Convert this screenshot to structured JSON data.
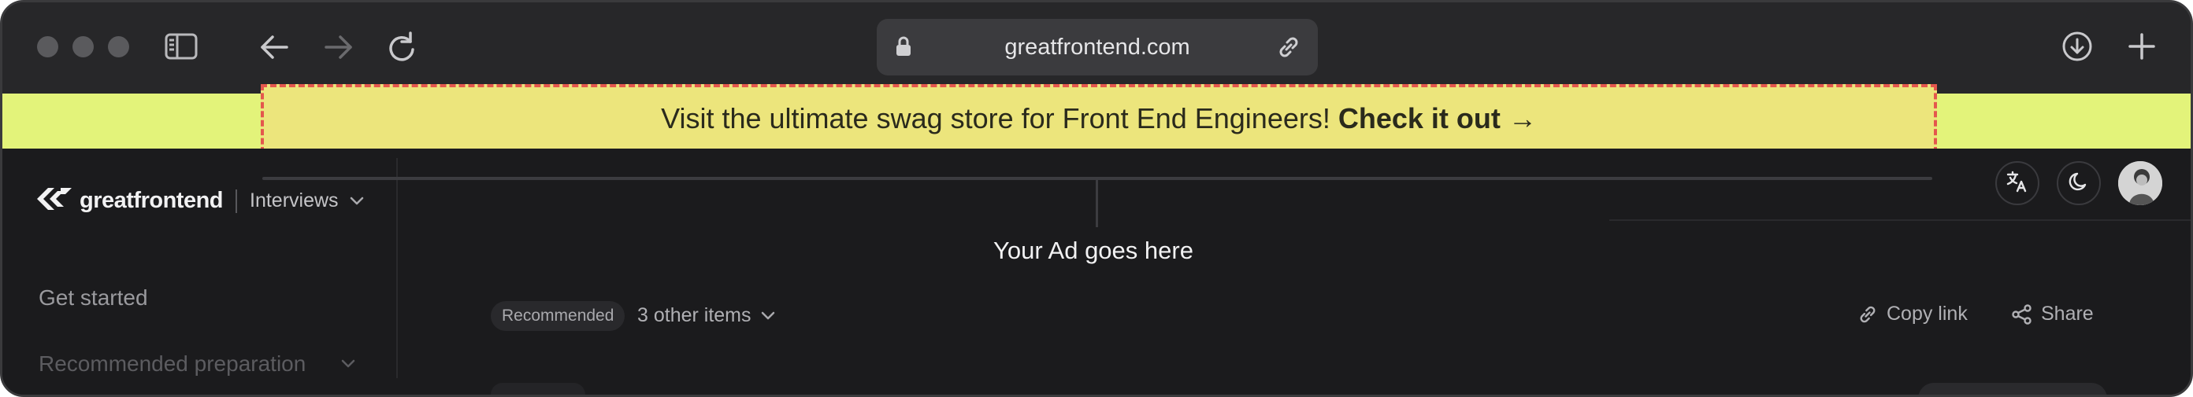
{
  "browser": {
    "url": "greatfrontend.com",
    "icons": [
      "sidebar-toggle-icon",
      "back-arrow-icon",
      "forward-arrow-icon",
      "reload-icon",
      "lock-icon",
      "link-icon",
      "download-icon",
      "plus-icon"
    ]
  },
  "banner": {
    "text": "Visit the ultimate swag store for Front End Engineers!",
    "cta": "Check it out →",
    "background": "#e3f37a"
  },
  "site": {
    "logo_text": "greatfrontend",
    "product_menu": "Interviews"
  },
  "sidebar": {
    "items": [
      {
        "label": "Get started"
      },
      {
        "label": "Recommended preparation"
      }
    ]
  },
  "ad": {
    "text": "Your Ad goes here"
  },
  "header_actions": {
    "icons": [
      "translate-icon",
      "moon-icon",
      "avatar"
    ]
  },
  "toolbar": {
    "badge": "Recommended",
    "other_items": "3 other items",
    "copy_link": "Copy link",
    "share": "Share"
  }
}
